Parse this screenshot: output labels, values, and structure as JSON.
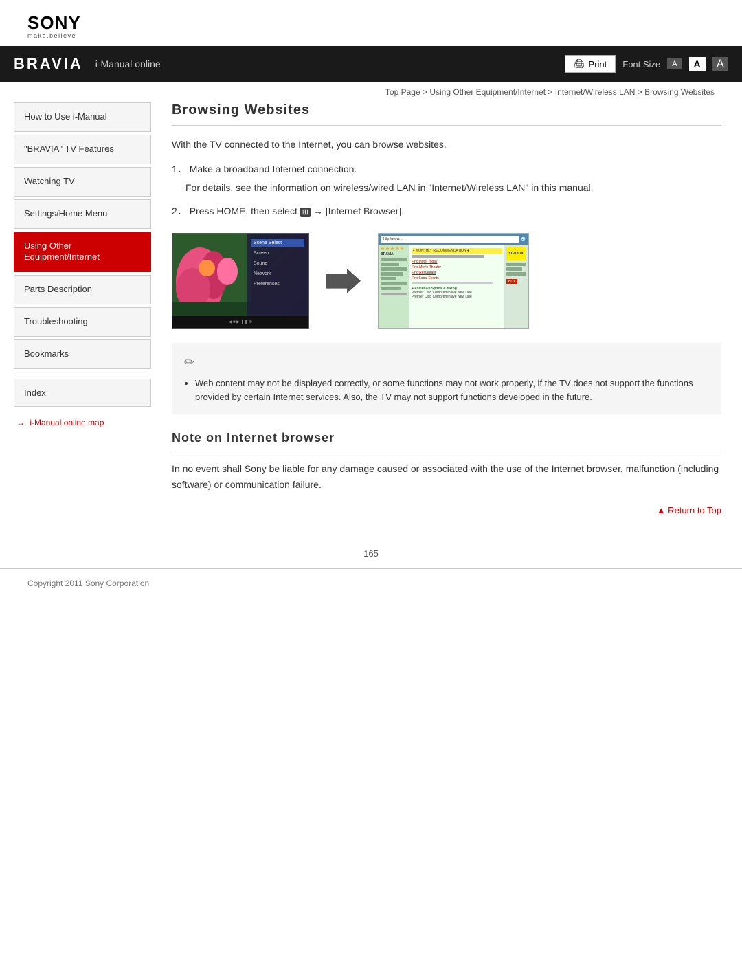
{
  "header": {
    "sony_logo": "SONY",
    "sony_tagline": "make.believe",
    "bravia_logo": "BRAVIA",
    "nav_title": "i-Manual online",
    "print_label": "Print",
    "font_size_label": "Font Size",
    "font_small": "A",
    "font_medium": "A",
    "font_large": "A"
  },
  "breadcrumb": {
    "top_page": "Top Page",
    "sep1": " > ",
    "link1": "Using Other Equipment/Internet",
    "sep2": " > ",
    "link2": "Internet/Wireless LAN",
    "sep3": " > ",
    "current": "Browsing Websites"
  },
  "sidebar": {
    "items": [
      {
        "id": "how-to-use",
        "label": "How to Use i-Manual",
        "active": false
      },
      {
        "id": "bravia-features",
        "label": "\"BRAVIA\" TV Features",
        "active": false
      },
      {
        "id": "watching-tv",
        "label": "Watching TV",
        "active": false
      },
      {
        "id": "settings-home",
        "label": "Settings/Home Menu",
        "active": false
      },
      {
        "id": "using-other",
        "label": "Using Other Equipment/Internet",
        "active": true
      },
      {
        "id": "parts-description",
        "label": "Parts Description",
        "active": false
      },
      {
        "id": "troubleshooting",
        "label": "Troubleshooting",
        "active": false
      },
      {
        "id": "bookmarks",
        "label": "Bookmarks",
        "active": false
      }
    ],
    "index_label": "Index",
    "map_link": "i-Manual online map"
  },
  "content": {
    "page_title": "Browsing Websites",
    "intro": "With the TV connected to the Internet, you can browse websites.",
    "step1_num": "1．",
    "step1_text": "Make a broadband Internet connection.",
    "step1_detail": "For details, see the information on wireless/wired LAN in \"Internet/Wireless LAN\" in this manual.",
    "step2_num": "2．",
    "step2_text": "Press HOME, then select   → [Internet Browser].",
    "note_icon": "🖊",
    "note_bullet": "Web content may not be displayed correctly, or some functions may not work properly, if the TV does not support the functions provided by certain Internet services. Also, the TV may not support functions developed in the future.",
    "section2_title": "Note on Internet browser",
    "section2_text": "In no event shall Sony be liable for any damage caused or associated with the use of the Internet browser, malfunction (including software) or communication failure.",
    "return_to_top": "▲ Return to Top"
  },
  "footer": {
    "copyright": "Copyright 2011 Sony Corporation",
    "page_number": "165"
  },
  "browser_screenshot": {
    "url": "http://www...",
    "highlight_text": "MONTHLY RECOMMENDATION ♦",
    "stars_count": 5
  },
  "tv_menu": {
    "items": [
      "Scene Select",
      "Screen",
      "Sound",
      "Network",
      "Preferences"
    ]
  }
}
